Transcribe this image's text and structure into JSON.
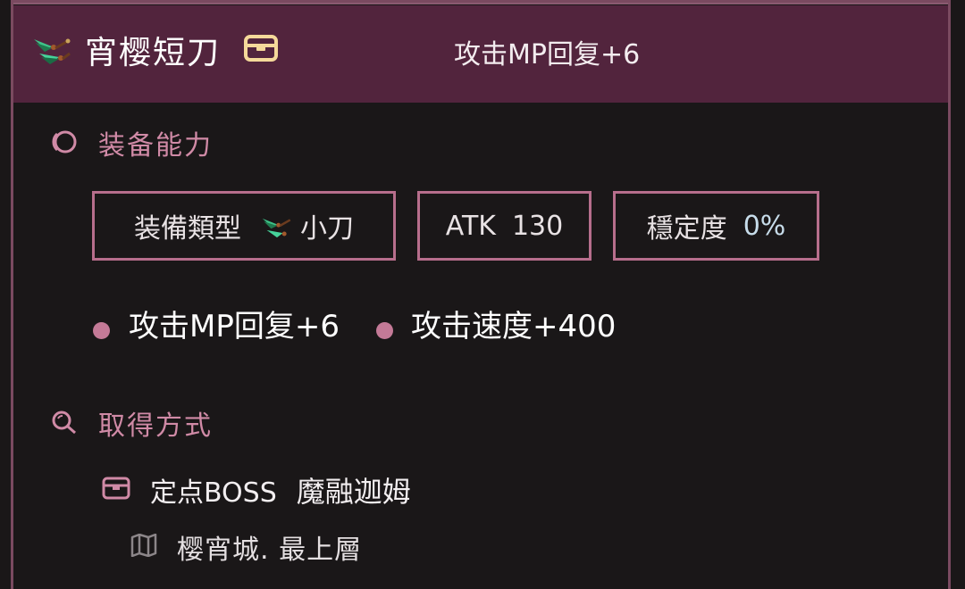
{
  "item": {
    "name": "宵樱短刀",
    "header_effect": "攻击MP回复+6",
    "weapon_icon": "green-kunai-icon",
    "chest_icon": "chest-icon"
  },
  "equip_section": {
    "title": "装备能力",
    "icon": "ring-icon",
    "stats": {
      "type_label": "装備類型",
      "type_value": "小刀",
      "atk_label": "ATK",
      "atk_value": "130",
      "stability_label": "穩定度",
      "stability_value": "0%"
    },
    "abilities": [
      "攻击MP回复+6",
      "攻击速度+400"
    ]
  },
  "obtain_section": {
    "title": "取得方式",
    "icon": "search-icon",
    "source_type": "定点BOSS",
    "source_name": "魔融迦姆",
    "location": "樱宵城. 最上層",
    "map_icon": "map-icon"
  },
  "colors": {
    "header_bg": "#52243d",
    "accent": "#d08aa6",
    "border": "#b76e8c",
    "value": "#c7dcea"
  }
}
